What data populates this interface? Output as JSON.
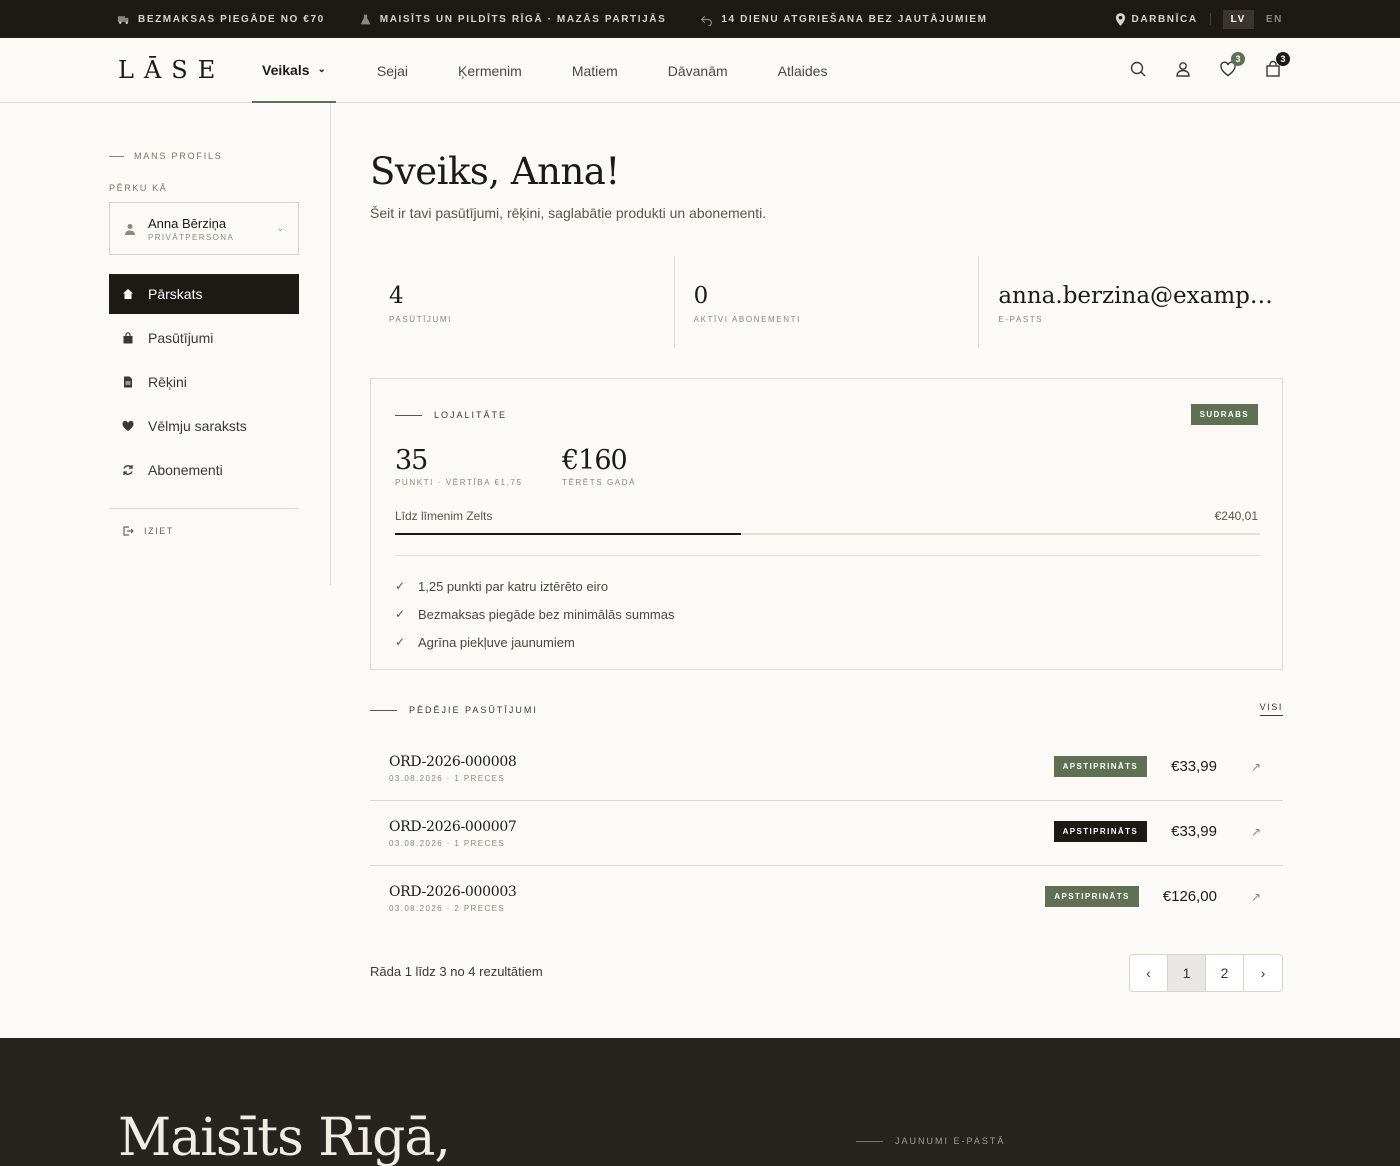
{
  "topbar": {
    "msg1": "BEZMAKSAS PIEGĀDE NO €70",
    "msg2": "MAISĪTS UN PILDĪTS RĪGĀ · MAZĀS PARTIJĀS",
    "msg3": "14 DIENU ATGRIEŠANA BEZ JAUTĀJUMIEM",
    "location": "DARBNĪCA",
    "lang_active": "LV",
    "lang_other": "EN"
  },
  "header": {
    "logo": "LĀSE",
    "nav": [
      "Veikals",
      "Sejai",
      "Ķermenim",
      "Matiem",
      "Dāvanām",
      "Atlaides"
    ],
    "wishlist_count": "3",
    "cart_count": "3"
  },
  "sidebar": {
    "section_label": "MANS PROFILS",
    "buy_as_label": "PĒRKU KĀ",
    "profile_name": "Anna Bērziņa",
    "profile_type": "PRIVĀTPERSONA",
    "menu": [
      "Pārskats",
      "Pasūtījumi",
      "Rēķini",
      "Vēlmju saraksts",
      "Abonementi"
    ],
    "logout": "IZIET"
  },
  "main": {
    "greeting": "Sveiks, Anna!",
    "subtitle": "Šeit ir tavi pasūtījumi, rēķini, saglabātie produkti un abonementi.",
    "stats": [
      {
        "value": "4",
        "label": "PASŪTĪJUMI"
      },
      {
        "value": "0",
        "label": "AKTĪVI ABONEMENTI"
      },
      {
        "value": "anna.berzina@exampl...",
        "label": "E-PASTS"
      }
    ]
  },
  "loyalty": {
    "title": "LOJALITĀTE",
    "tier": "SUDRABS",
    "points": "35",
    "points_label": "PUNKTI · VĒRTĪBA €1,75",
    "spent": "€160",
    "spent_label": "TĒRĒTS GADĀ",
    "progress_label": "Līdz līmenim Zelts",
    "progress_amount": "€240,01",
    "progress_fraction": 0.4,
    "perks": [
      "1,25 punkti par katru iztērēto eiro",
      "Bezmaksas piegāde bez minimālās summas",
      "Agrīna piekļuve jaunumiem"
    ]
  },
  "orders": {
    "title": "PĒDĒJIE PASŪTĪJUMI",
    "all_link": "VISI",
    "items": [
      {
        "id": "ORD-2026-000008",
        "meta": "03.08.2026 · 1 PRECES",
        "status": "APSTIPRINĀTS",
        "price": "€33,99"
      },
      {
        "id": "ORD-2026-000007",
        "meta": "03.08.2026 · 1 PRECES",
        "status": "APSTIPRINĀTS",
        "price": "€33,99"
      },
      {
        "id": "ORD-2026-000003",
        "meta": "03.08.2026 · 2 PRECES",
        "status": "APSTIPRINĀTS",
        "price": "€126,00"
      }
    ],
    "results_text": "Rāda 1 līdz 3 no 4 rezultātiem",
    "pages": [
      "1",
      "2"
    ]
  },
  "footer": {
    "headline": "Maisīts Rīgā,",
    "newsletter_label": "JAUNUMI E-PASTĀ"
  },
  "colors": {
    "accent_green": "#5f7055",
    "dark": "#1d1915",
    "background": "#fbfaf6"
  }
}
